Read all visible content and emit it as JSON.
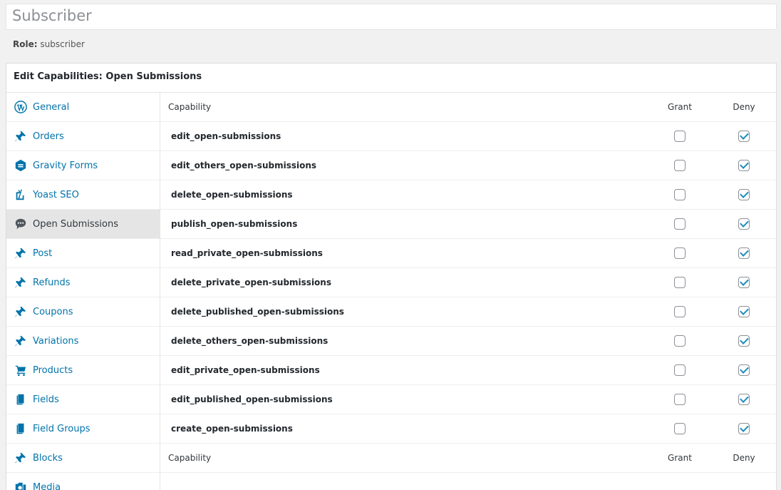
{
  "page": {
    "title_value": "Subscriber",
    "role_label": "Role:",
    "role_value": "subscriber"
  },
  "panel": {
    "heading": "Edit Capabilities: Open Submissions"
  },
  "sidebar": {
    "items": [
      {
        "label": "General",
        "icon": "wordpress-icon",
        "active": false
      },
      {
        "label": "Orders",
        "icon": "pushpin-icon",
        "active": false
      },
      {
        "label": "Gravity Forms",
        "icon": "gravity-forms-icon",
        "active": false
      },
      {
        "label": "Yoast SEO",
        "icon": "yoast-icon",
        "active": false
      },
      {
        "label": "Open Submissions",
        "icon": "speech-bubble-icon",
        "active": true
      },
      {
        "label": "Post",
        "icon": "pushpin-icon",
        "active": false
      },
      {
        "label": "Refunds",
        "icon": "pushpin-icon",
        "active": false
      },
      {
        "label": "Coupons",
        "icon": "pushpin-icon",
        "active": false
      },
      {
        "label": "Variations",
        "icon": "pushpin-icon",
        "active": false
      },
      {
        "label": "Products",
        "icon": "cart-icon",
        "active": false
      },
      {
        "label": "Fields",
        "icon": "pages-icon",
        "active": false
      },
      {
        "label": "Field Groups",
        "icon": "pages-icon",
        "active": false
      },
      {
        "label": "Blocks",
        "icon": "pushpin-icon",
        "active": false
      },
      {
        "label": "Media",
        "icon": "media-icon",
        "active": false
      }
    ]
  },
  "table": {
    "header": {
      "capability": "Capability",
      "grant": "Grant",
      "deny": "Deny"
    },
    "footer": {
      "capability": "Capability",
      "grant": "Grant",
      "deny": "Deny"
    },
    "rows": [
      {
        "name": "edit_open-submissions",
        "grant": false,
        "deny": true
      },
      {
        "name": "edit_others_open-submissions",
        "grant": false,
        "deny": true
      },
      {
        "name": "delete_open-submissions",
        "grant": false,
        "deny": true
      },
      {
        "name": "publish_open-submissions",
        "grant": false,
        "deny": true
      },
      {
        "name": "read_private_open-submissions",
        "grant": false,
        "deny": true
      },
      {
        "name": "delete_private_open-submissions",
        "grant": false,
        "deny": true
      },
      {
        "name": "delete_published_open-submissions",
        "grant": false,
        "deny": true
      },
      {
        "name": "delete_others_open-submissions",
        "grant": false,
        "deny": true
      },
      {
        "name": "edit_private_open-submissions",
        "grant": false,
        "deny": true
      },
      {
        "name": "edit_published_open-submissions",
        "grant": false,
        "deny": true
      },
      {
        "name": "create_open-submissions",
        "grant": false,
        "deny": true
      }
    ]
  },
  "colors": {
    "link": "#0073aa",
    "active_bg": "#e5e5e5",
    "check": "#1e8cbe"
  }
}
